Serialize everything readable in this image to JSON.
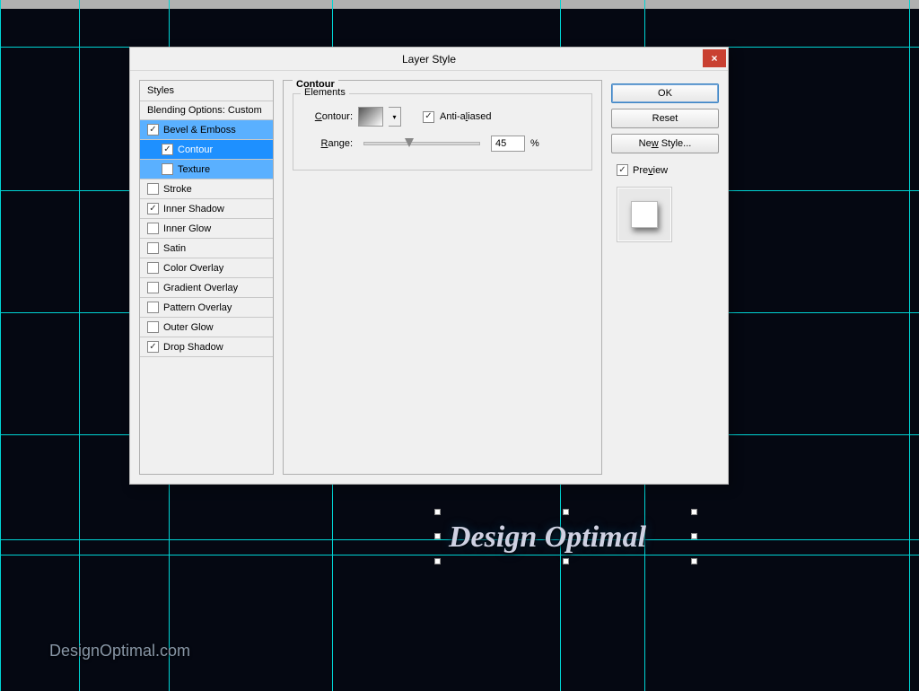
{
  "dialog": {
    "title": "Layer Style",
    "close_icon": "×",
    "panel_title": "Contour",
    "fieldset_label": "Elements",
    "contour_label": "Contour:",
    "antialias_label": "Anti-aliased",
    "antialias_checked": true,
    "range_label": "Range:",
    "range_value": "45",
    "range_unit": "%",
    "styles_header": "Styles",
    "styles": [
      {
        "label": "Blending Options: Custom",
        "checkbox": false,
        "checked": false,
        "sub": false,
        "selected": false
      },
      {
        "label": "Bevel & Emboss",
        "checkbox": true,
        "checked": true,
        "sub": false,
        "selected": "group"
      },
      {
        "label": "Contour",
        "checkbox": true,
        "checked": true,
        "sub": true,
        "selected": true
      },
      {
        "label": "Texture",
        "checkbox": true,
        "checked": false,
        "sub": true,
        "selected": "group"
      },
      {
        "label": "Stroke",
        "checkbox": true,
        "checked": false,
        "sub": false,
        "selected": false
      },
      {
        "label": "Inner Shadow",
        "checkbox": true,
        "checked": true,
        "sub": false,
        "selected": false
      },
      {
        "label": "Inner Glow",
        "checkbox": true,
        "checked": false,
        "sub": false,
        "selected": false
      },
      {
        "label": "Satin",
        "checkbox": true,
        "checked": false,
        "sub": false,
        "selected": false
      },
      {
        "label": "Color Overlay",
        "checkbox": true,
        "checked": false,
        "sub": false,
        "selected": false
      },
      {
        "label": "Gradient Overlay",
        "checkbox": true,
        "checked": false,
        "sub": false,
        "selected": false
      },
      {
        "label": "Pattern Overlay",
        "checkbox": true,
        "checked": false,
        "sub": false,
        "selected": false
      },
      {
        "label": "Outer Glow",
        "checkbox": true,
        "checked": false,
        "sub": false,
        "selected": false
      },
      {
        "label": "Drop Shadow",
        "checkbox": true,
        "checked": true,
        "sub": false,
        "selected": false
      }
    ],
    "buttons": {
      "ok": "OK",
      "reset": "Reset",
      "new_style": "New Style...",
      "preview": "Preview",
      "preview_checked": true
    }
  },
  "canvas": {
    "text": "Design Optimal",
    "watermark": "DesignOptimal.com",
    "guides_v": [
      0,
      88,
      188,
      370,
      624,
      718,
      1013
    ],
    "guides_h": [
      52,
      212,
      348,
      484,
      601,
      618
    ]
  }
}
